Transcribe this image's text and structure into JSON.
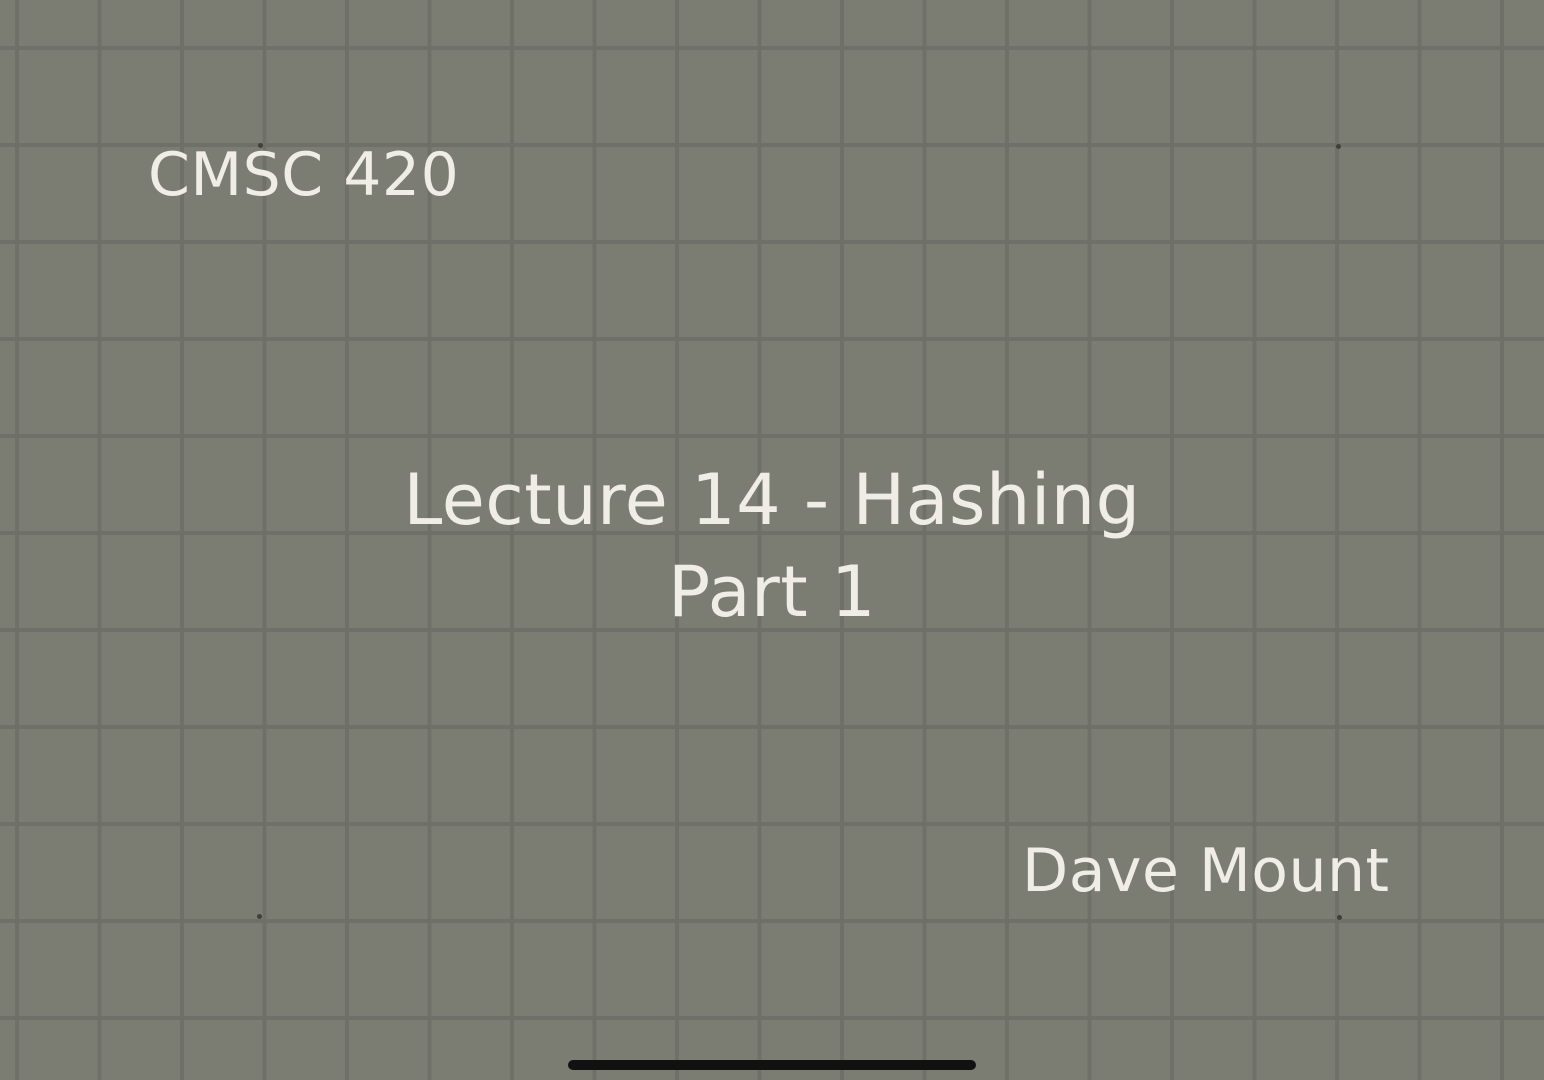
{
  "slide": {
    "course": "CMSC 420",
    "title_line1": "Lecture 14 - Hashing",
    "title_line2": "Part 1",
    "author": "Dave Mount"
  },
  "colors": {
    "background": "#7c7d72",
    "grid_line": "#6e7068",
    "text": "#efede6",
    "home_indicator": "#111111"
  }
}
